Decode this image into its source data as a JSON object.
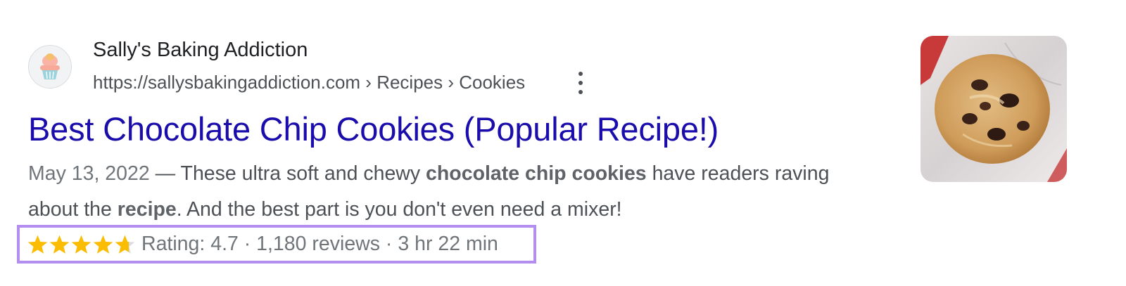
{
  "result": {
    "site_name": "Sally's Baking Addiction",
    "breadcrumb": "https://sallysbakingaddiction.com › Recipes › Cookies",
    "more_icon": "more-vert-icon",
    "favicon_icon": "cupcake-icon",
    "title": "Best Chocolate Chip Cookies (Popular Recipe!)",
    "snippet": {
      "date": "May 13, 2022",
      "separator": " — ",
      "part1": "These ultra soft and chewy ",
      "bold1": "chocolate chip cookies",
      "part2": " have readers raving about the ",
      "bold2": "recipe",
      "part3": ". And the best part is you don't even need a mixer!"
    },
    "rich": {
      "stars_value": 4.7,
      "stars_max": 5,
      "star_color": "#fbbc04",
      "star_empty_color": "#dadce0",
      "text": "Rating: 4.7 · 1,180 reviews · 3 hr 22 min",
      "highlight_color": "#b48df0"
    },
    "thumbnail_icon": "cookie-image"
  }
}
